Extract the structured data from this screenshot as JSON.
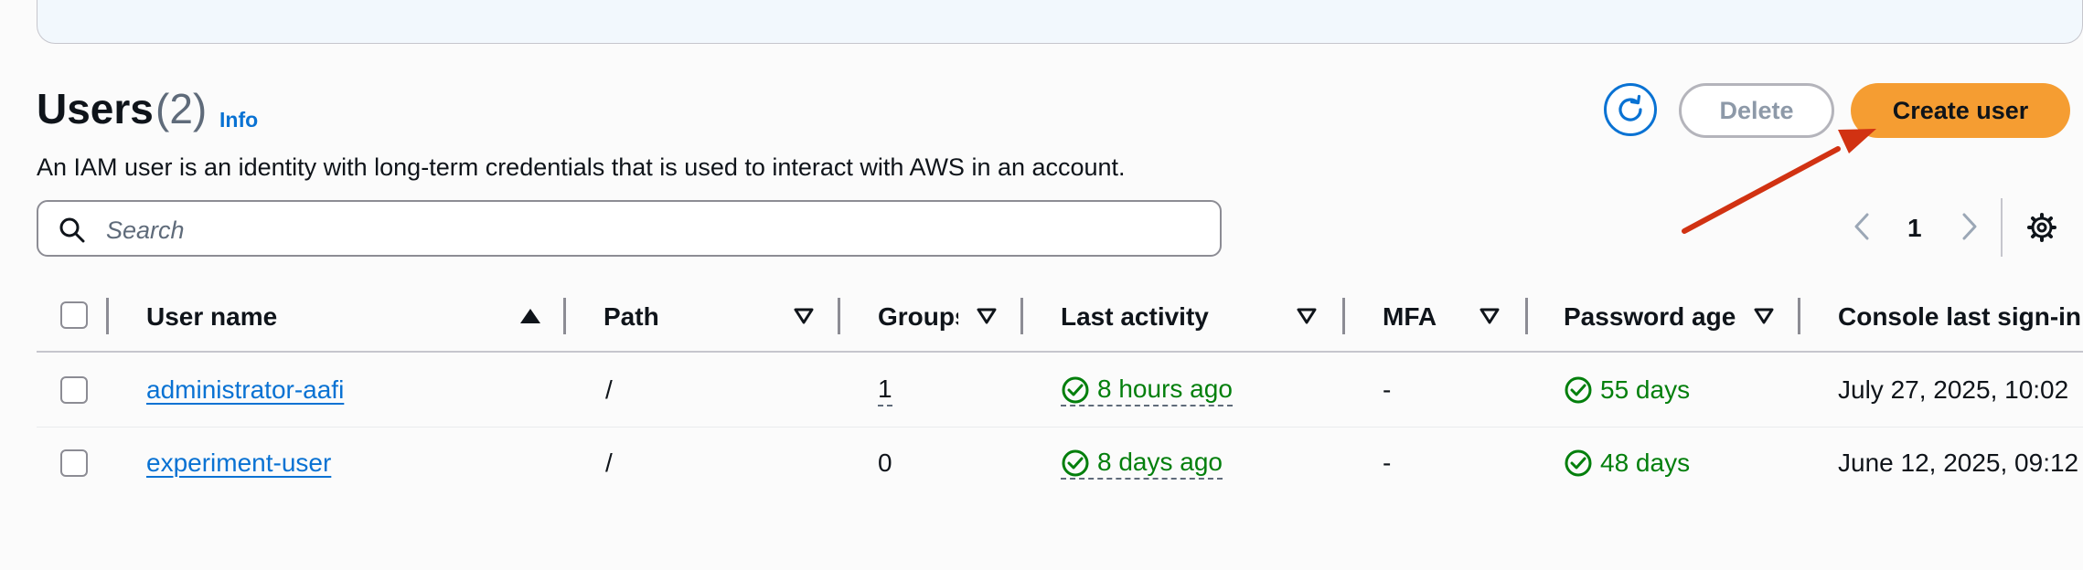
{
  "header": {
    "title": "Users",
    "count": "(2)",
    "info_label": "Info",
    "description": "An IAM user is an identity with long-term credentials that is used to interact with AWS in an account."
  },
  "actions": {
    "refresh_icon": "refresh-icon",
    "delete_label": "Delete",
    "create_label": "Create user"
  },
  "search": {
    "placeholder": "Search",
    "value": ""
  },
  "pagination": {
    "current_page": "1"
  },
  "table": {
    "columns": [
      "User name",
      "Path",
      "Groups",
      "Last activity",
      "MFA",
      "Password age",
      "Console last sign-in"
    ],
    "sort": {
      "column": "User name",
      "direction": "ascending"
    },
    "rows": [
      {
        "user_name": "administrator-aafi",
        "path": "/",
        "groups": "1",
        "last_activity": "8 hours ago",
        "mfa": "-",
        "password_age": "55 days",
        "console_last_sign_in": "July 27, 2025, 10:02"
      },
      {
        "user_name": "experiment-user",
        "path": "/",
        "groups": "0",
        "last_activity": "8 days ago",
        "mfa": "-",
        "password_age": "48 days",
        "console_last_sign_in": "June 12, 2025, 09:12"
      }
    ]
  },
  "colors": {
    "primary_button": "#f59d32",
    "link": "#0972d3",
    "success": "#037f0c",
    "annotation_arrow": "#d13212"
  }
}
